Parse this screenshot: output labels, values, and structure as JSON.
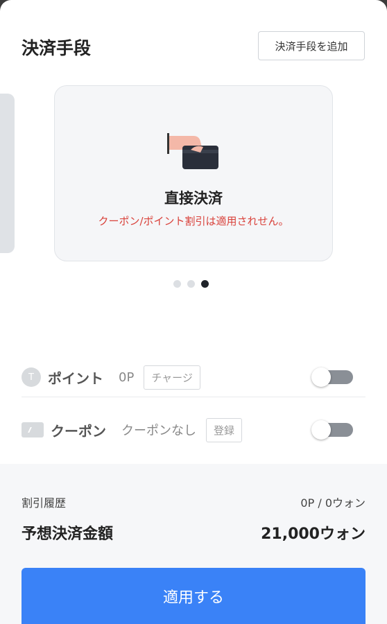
{
  "header": {
    "title": "決済手段",
    "add_button": "決済手段を追加"
  },
  "payment_card": {
    "title": "直接決済",
    "note": "クーポン/ポイント割引は適用されせん。",
    "icon": "hand-card-icon",
    "pagination": {
      "total": 3,
      "active_index": 2
    }
  },
  "point_row": {
    "badge": "T",
    "label": "ポイント",
    "value": "0P",
    "button": "チャージ",
    "toggle_on": false
  },
  "coupon_row": {
    "label": "クーポン",
    "value": "クーポンなし",
    "button": "登録",
    "toggle_on": false
  },
  "summary": {
    "discount_label": "割引履歴",
    "discount_value": "0P / 0ウォン",
    "total_label": "予想決済金額",
    "total_value": "21,000ウォン"
  },
  "apply_button": "適用する",
  "colors": {
    "accent": "#3a82f7",
    "warning": "#d9413a"
  }
}
